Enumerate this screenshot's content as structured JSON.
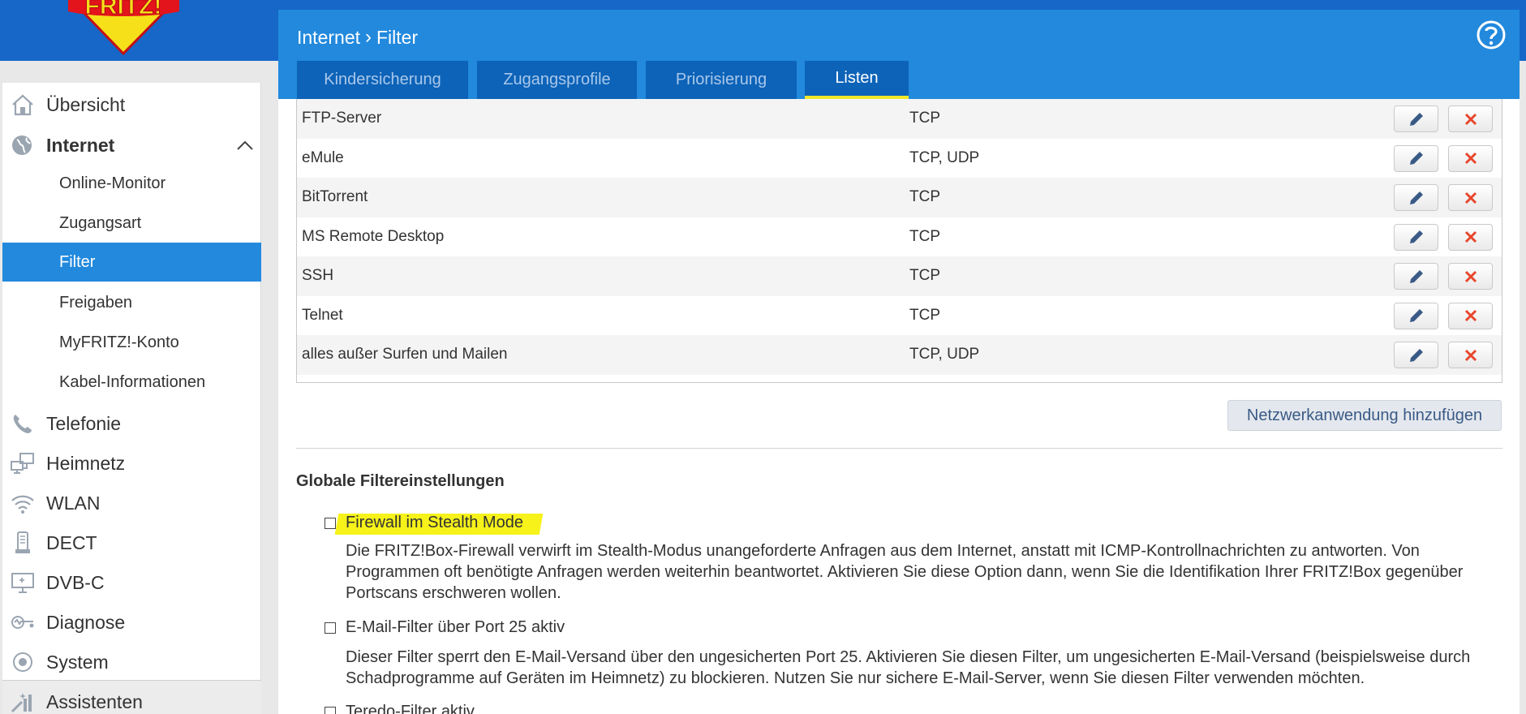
{
  "logo": {
    "text": "FRITZ!"
  },
  "header": {
    "breadcrumb_root": "Internet",
    "breadcrumb_sep": "›",
    "breadcrumb_current": "Filter"
  },
  "tabs": [
    {
      "label": "Kindersicherung",
      "active": false
    },
    {
      "label": "Zugangsprofile",
      "active": false
    },
    {
      "label": "Priorisierung",
      "active": false
    },
    {
      "label": "Listen",
      "active": true
    }
  ],
  "sidebar": {
    "items": [
      {
        "label": "Übersicht",
        "icon": "home-icon"
      },
      {
        "label": "Internet",
        "icon": "globe-icon",
        "expanded": true
      },
      {
        "label": "Telefonie",
        "icon": "phone-icon"
      },
      {
        "label": "Heimnetz",
        "icon": "network-icon"
      },
      {
        "label": "WLAN",
        "icon": "wifi-icon"
      },
      {
        "label": "DECT",
        "icon": "dect-icon"
      },
      {
        "label": "DVB-C",
        "icon": "tv-icon"
      },
      {
        "label": "Diagnose",
        "icon": "diagnose-icon"
      },
      {
        "label": "System",
        "icon": "system-icon"
      },
      {
        "label": "Assistenten",
        "icon": "wizard-icon"
      }
    ],
    "subitems": [
      {
        "label": "Online-Monitor"
      },
      {
        "label": "Zugangsart"
      },
      {
        "label": "Filter",
        "active": true
      },
      {
        "label": "Freigaben"
      },
      {
        "label": "MyFRITZ!-Konto"
      },
      {
        "label": "Kabel-Informationen"
      }
    ]
  },
  "applications": {
    "rows": [
      {
        "name": "FTP-Server",
        "protocol": "TCP"
      },
      {
        "name": "eMule",
        "protocol": "TCP, UDP"
      },
      {
        "name": "BitTorrent",
        "protocol": "TCP"
      },
      {
        "name": "MS Remote Desktop",
        "protocol": "TCP"
      },
      {
        "name": "SSH",
        "protocol": "TCP"
      },
      {
        "name": "Telnet",
        "protocol": "TCP"
      },
      {
        "name": "alles außer Surfen und Mailen",
        "protocol": "TCP, UDP"
      }
    ],
    "add_button": "Netzwerkanwendung hinzufügen"
  },
  "global_settings": {
    "title": "Globale Filtereinstellungen",
    "options": [
      {
        "label": "Firewall im Stealth Mode",
        "checked": false,
        "description": "Die FRITZ!Box-Firewall verwirft im Stealth-Modus unangeforderte Anfragen aus dem Internet, anstatt mit ICMP-Kontrollnachrichten zu antworten. Von Programmen oft benötigte Anfragen werden weiterhin beantwortet. Aktivieren Sie diese Option dann, wenn Sie die Identifikation Ihrer FRITZ!Box gegenüber Portscans erschweren wollen."
      },
      {
        "label": "E-Mail-Filter über Port 25 aktiv",
        "checked": false,
        "description": "Dieser Filter sperrt den E-Mail-Versand über den ungesicherten Port 25. Aktivieren Sie diesen Filter, um ungesicherten E-Mail-Versand (beispielsweise durch Schadprogramme auf Geräten im Heimnetz) zu blockieren. Nutzen Sie nur sichere E-Mail-Server, wenn Sie diesen Filter verwenden möchten."
      },
      {
        "label": "Teredo-Filter aktiv",
        "checked": false
      }
    ]
  },
  "colors": {
    "brand_blue": "#1667c8",
    "header_blue": "#2289dd",
    "tab_blue": "#0c63b8",
    "active_tab_underline": "#f2e82a",
    "delete_red": "#e8462c",
    "edit_blue": "#3a5a86",
    "highlight_yellow": "#f6f21a"
  }
}
